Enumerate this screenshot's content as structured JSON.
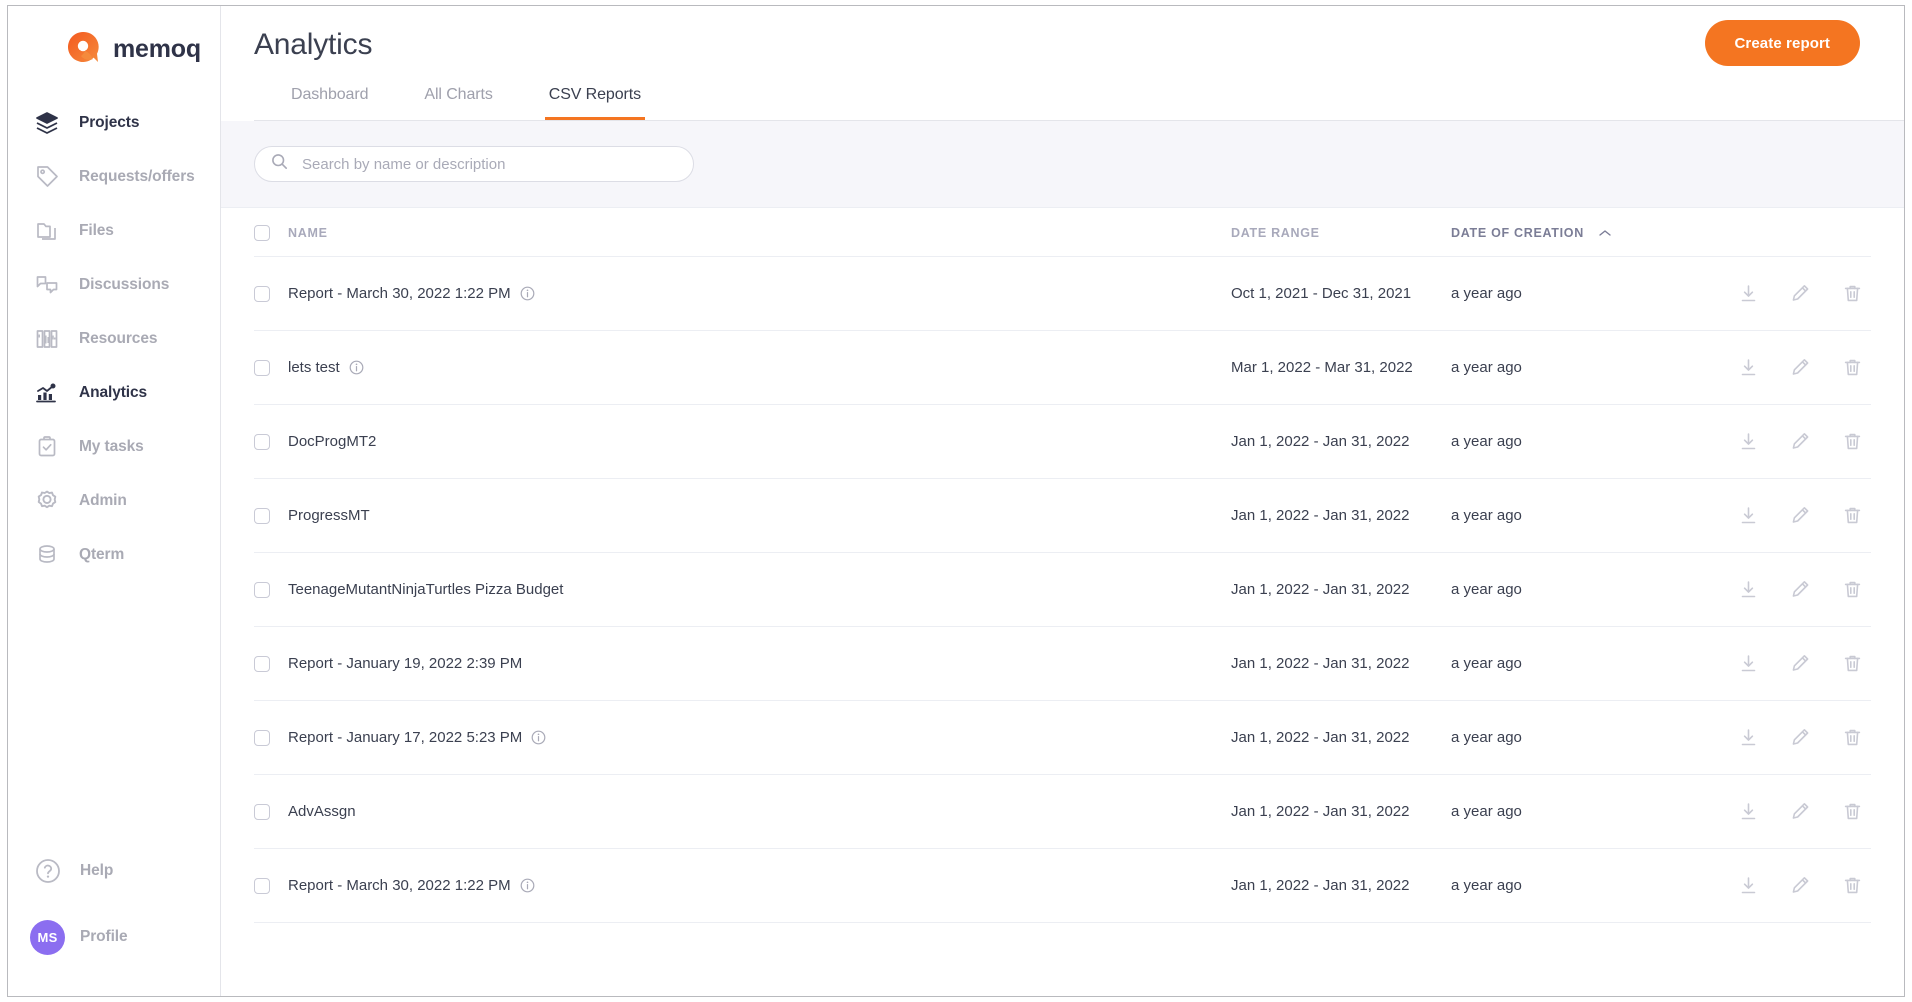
{
  "brand": {
    "name": "memoq",
    "accent": "#f47521"
  },
  "sidebar": {
    "items": [
      {
        "label": "Projects",
        "icon": "layers-icon",
        "active": true
      },
      {
        "label": "Requests/offers",
        "icon": "tag-icon",
        "active": false
      },
      {
        "label": "Files",
        "icon": "folder-icon",
        "active": false
      },
      {
        "label": "Discussions",
        "icon": "chat-icon",
        "active": false
      },
      {
        "label": "Resources",
        "icon": "library-icon",
        "active": false
      },
      {
        "label": "Analytics",
        "icon": "chart-icon",
        "active": true
      },
      {
        "label": "My tasks",
        "icon": "clipboard-icon",
        "active": false
      },
      {
        "label": "Admin",
        "icon": "gear-icon",
        "active": false
      },
      {
        "label": "Qterm",
        "icon": "database-icon",
        "active": false
      }
    ],
    "bottom": [
      {
        "label": "Help",
        "icon": "help-icon"
      },
      {
        "label": "Profile",
        "icon": "avatar",
        "initials": "MS",
        "avatar_color": "#8b6ef0"
      }
    ]
  },
  "header": {
    "title": "Analytics",
    "create_report_label": "Create report"
  },
  "tabs": [
    {
      "label": "Dashboard",
      "active": false
    },
    {
      "label": "All Charts",
      "active": false
    },
    {
      "label": "CSV Reports",
      "active": true
    }
  ],
  "search": {
    "placeholder": "Search by name or description",
    "value": ""
  },
  "table": {
    "columns": {
      "name": "NAME",
      "date_range": "DATE RANGE",
      "date_of_creation": "DATE OF CREATION"
    },
    "sort": {
      "column": "DATE OF CREATION",
      "direction": "asc",
      "caret": "chevron-up-icon"
    },
    "actions": {
      "download": "download-icon",
      "edit": "edit-icon",
      "delete": "delete-icon"
    },
    "rows": [
      {
        "name": "Report - March 30, 2022 1:22 PM",
        "info": true,
        "date_range": "Oct 1, 2021 - Dec 31, 2021",
        "date_of_creation": "a year ago"
      },
      {
        "name": "lets test",
        "info": true,
        "date_range": "Mar 1, 2022 - Mar 31, 2022",
        "date_of_creation": "a year ago"
      },
      {
        "name": "DocProgMT2",
        "info": false,
        "date_range": "Jan 1, 2022 - Jan 31, 2022",
        "date_of_creation": "a year ago"
      },
      {
        "name": "ProgressMT",
        "info": false,
        "date_range": "Jan 1, 2022 - Jan 31, 2022",
        "date_of_creation": "a year ago"
      },
      {
        "name": "TeenageMutantNinjaTurtles Pizza Budget",
        "info": false,
        "date_range": "Jan 1, 2022 - Jan 31, 2022",
        "date_of_creation": "a year ago"
      },
      {
        "name": "Report - January 19, 2022 2:39 PM",
        "info": false,
        "date_range": "Jan 1, 2022 - Jan 31, 2022",
        "date_of_creation": "a year ago"
      },
      {
        "name": "Report - January 17, 2022 5:23 PM",
        "info": true,
        "date_range": "Jan 1, 2022 - Jan 31, 2022",
        "date_of_creation": "a year ago"
      },
      {
        "name": "AdvAssgn",
        "info": false,
        "date_range": "Jan 1, 2022 - Jan 31, 2022",
        "date_of_creation": "a year ago"
      },
      {
        "name": "Report - March 30, 2022 1:22 PM",
        "info": true,
        "date_range": "Jan 1, 2022 - Jan 31, 2022",
        "date_of_creation": "a year ago"
      }
    ]
  }
}
